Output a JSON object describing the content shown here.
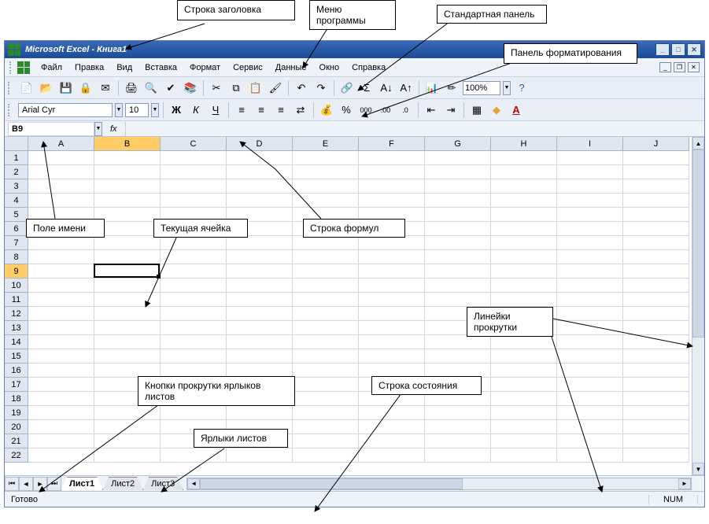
{
  "callouts": {
    "titlebar": "Строка заголовка",
    "menu": "Меню программы",
    "stdtoolbar": "Стандартная панель",
    "fmttoolbar": "Панель форматирования",
    "namebox": "Поле имени",
    "active_cell": "Текущая ячейка",
    "formula_bar": "Строка формул",
    "scrollbars": "Линейки прокрутки",
    "tab_scroll": "Кнопки прокрутки ярлыков листов",
    "sheet_tabs": "Ярлыки листов",
    "statusbar": "Строка состояния"
  },
  "title": "Microsoft Excel - Книга1",
  "menu": [
    "Файл",
    "Правка",
    "Вид",
    "Вставка",
    "Формат",
    "Сервис",
    "Данные",
    "Окно",
    "Справка"
  ],
  "zoom": "100%",
  "font_name": "Arial Cyr",
  "font_size": "10",
  "fmt_bold": "Ж",
  "fmt_italic": "К",
  "fmt_underline": "Ч",
  "fmt_percent": "%",
  "fmt_thousands": "000",
  "name_box": "B9",
  "fx_label": "fx",
  "columns": [
    "A",
    "B",
    "C",
    "D",
    "E",
    "F",
    "G",
    "H",
    "I",
    "J"
  ],
  "rows": [
    "1",
    "2",
    "3",
    "4",
    "5",
    "6",
    "7",
    "8",
    "9",
    "10",
    "11",
    "12",
    "13",
    "14",
    "15",
    "16",
    "17",
    "18",
    "19",
    "20",
    "21",
    "22"
  ],
  "active_row_index": 8,
  "active_col_index": 1,
  "sheets": [
    "Лист1",
    "Лист2",
    "Лист3"
  ],
  "status_ready": "Готово",
  "status_num": "NUM"
}
